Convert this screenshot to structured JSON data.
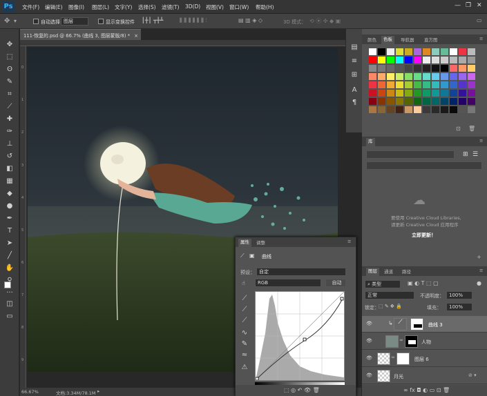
{
  "app": {
    "logo": "Ps"
  },
  "menu": [
    "文件(F)",
    "编辑(E)",
    "图像(I)",
    "图层(L)",
    "文字(Y)",
    "选择(S)",
    "滤镜(T)",
    "3D(D)",
    "视图(V)",
    "窗口(W)",
    "帮助(H)"
  ],
  "options": {
    "auto_select_label": "自动选择：",
    "auto_select_value": "图层",
    "show_transform": "显示变换控件",
    "mode3d": "3D 模式："
  },
  "document_tab": {
    "title": "111-恢复的.psd @ 66.7% (曲线 3, 图层蒙版/8) *",
    "close": "×"
  },
  "ruler_v": [
    "0",
    "1",
    "2",
    "3",
    "4",
    "5",
    "6",
    "7",
    "8",
    "9"
  ],
  "status": {
    "zoom": "66.67%",
    "doc": "文档:3.34M/78.1M"
  },
  "color_panel": {
    "tabs": [
      "颜色",
      "色板",
      "导航器",
      "直方图"
    ],
    "active": "色板"
  },
  "library_panel": {
    "tab": "库",
    "message1": "要使用 Creative Cloud Libraries,",
    "message2": "请更新 Creative Cloud 应用程序",
    "link": "立即更新！"
  },
  "properties_panel": {
    "tabs": [
      "属性",
      "调整"
    ],
    "title": "曲线",
    "preset_label": "预设：",
    "preset_value": "自定",
    "channel": "RGB",
    "auto": "自动"
  },
  "layers_panel": {
    "tabs": [
      "图层",
      "通道",
      "路径"
    ],
    "kind": "类型",
    "blend": "正常",
    "opacity_label": "不透明度：",
    "opacity": "100%",
    "lock_label": "锁定：",
    "fill_label": "填充：",
    "fill": "100%",
    "layers": [
      {
        "name": "曲线 3"
      },
      {
        "name": "人物"
      },
      {
        "name": "图层 6"
      },
      {
        "name": "月光"
      }
    ]
  },
  "colors": {
    "accent": "#33b6ff",
    "panel": "#535353",
    "menubar": "#353535"
  }
}
